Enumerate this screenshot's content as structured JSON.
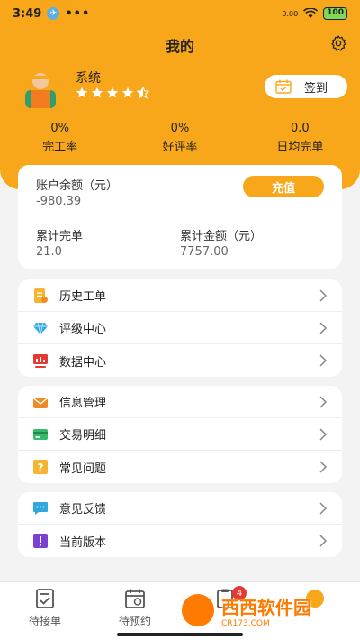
{
  "status_bar": {
    "time": "3:49",
    "dots": "•••",
    "net_speed": "0.00",
    "battery": "100"
  },
  "header": {
    "title": "我的"
  },
  "profile": {
    "name": "系统",
    "rating_stars": 4.5
  },
  "signin": {
    "label": "签到"
  },
  "stats": [
    {
      "value": "0%",
      "label": "完工率"
    },
    {
      "value": "0%",
      "label": "好评率"
    },
    {
      "value": "0.0",
      "label": "日均完单"
    }
  ],
  "account": {
    "balance_label": "账户余额（元）",
    "balance_value": "-980.39",
    "recharge_label": "充值",
    "total_orders_label": "累计完单",
    "total_orders_value": "21.0",
    "total_amount_label": "累计金额（元）",
    "total_amount_value": "7757.00"
  },
  "menu_group1": [
    {
      "label": "历史工单",
      "icon": "history-orders-icon"
    },
    {
      "label": "评级中心",
      "icon": "rating-diamond-icon"
    },
    {
      "label": "数据中心",
      "icon": "data-center-icon"
    }
  ],
  "menu_group2": [
    {
      "label": "信息管理",
      "icon": "message-icon"
    },
    {
      "label": "交易明细",
      "icon": "card-icon"
    },
    {
      "label": "常见问题",
      "icon": "question-icon"
    }
  ],
  "menu_group3": [
    {
      "label": "意见反馈",
      "icon": "feedback-icon"
    },
    {
      "label": "当前版本",
      "icon": "version-icon"
    }
  ],
  "tabbar": {
    "tabs": [
      {
        "label": "待接单"
      },
      {
        "label": "待预约"
      }
    ],
    "badge": "4"
  },
  "watermark": {
    "main": "西西软件园",
    "sub": "CR173.COM"
  },
  "colors": {
    "accent": "#f8a71a",
    "background": "#f3f3f3"
  }
}
